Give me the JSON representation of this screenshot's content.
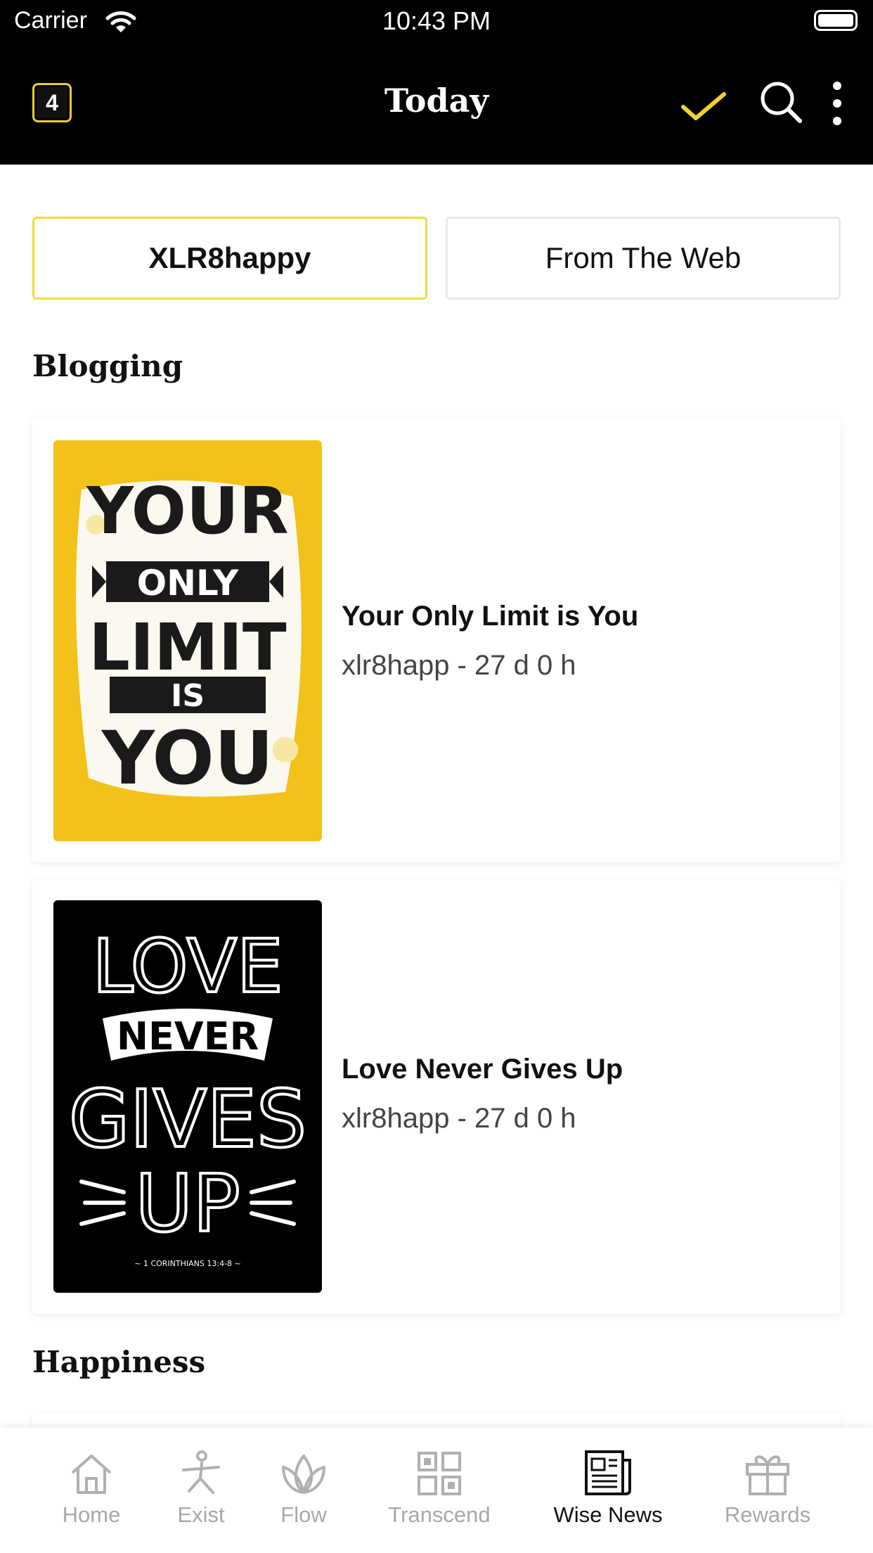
{
  "status_bar": {
    "carrier": "Carrier",
    "time": "10:43 PM"
  },
  "nav": {
    "badge_count": "4",
    "title": "Today",
    "icons": [
      "check-icon",
      "search-icon",
      "more-vertical-icon"
    ],
    "accent_color": "#f2d22e"
  },
  "segments": [
    {
      "label": "XLR8happy",
      "selected": true
    },
    {
      "label": "From The Web",
      "selected": false
    }
  ],
  "sections": [
    {
      "title": "Blogging",
      "posts": [
        {
          "title": "Your Only Limit is You",
          "meta": "xlr8happ - 27 d 0 h",
          "poster": {
            "top": "YOUR",
            "band": "ONLY",
            "mid": "LIMIT",
            "small": "IS",
            "bottom": "YOU"
          }
        },
        {
          "title": "Love Never Gives Up",
          "meta": "xlr8happ - 27 d 0 h",
          "poster": {
            "top": "LOVE",
            "band": "NEVER",
            "mid": "GIVES",
            "bottom": "UP",
            "verse": "~ 1 CORINTHIANS 13:4-8 ~"
          }
        }
      ]
    },
    {
      "title": "Happiness",
      "posts": []
    }
  ],
  "tabbar": {
    "items": [
      {
        "label": "Home",
        "icon": "home-icon",
        "active": false
      },
      {
        "label": "Exist",
        "icon": "yoga-pose-icon",
        "active": false
      },
      {
        "label": "Flow",
        "icon": "lotus-icon",
        "active": false
      },
      {
        "label": "Transcend",
        "icon": "grid-icon",
        "active": false
      },
      {
        "label": "Wise News",
        "icon": "newspaper-icon",
        "active": true
      },
      {
        "label": "Rewards",
        "icon": "gift-icon",
        "active": false
      }
    ]
  }
}
